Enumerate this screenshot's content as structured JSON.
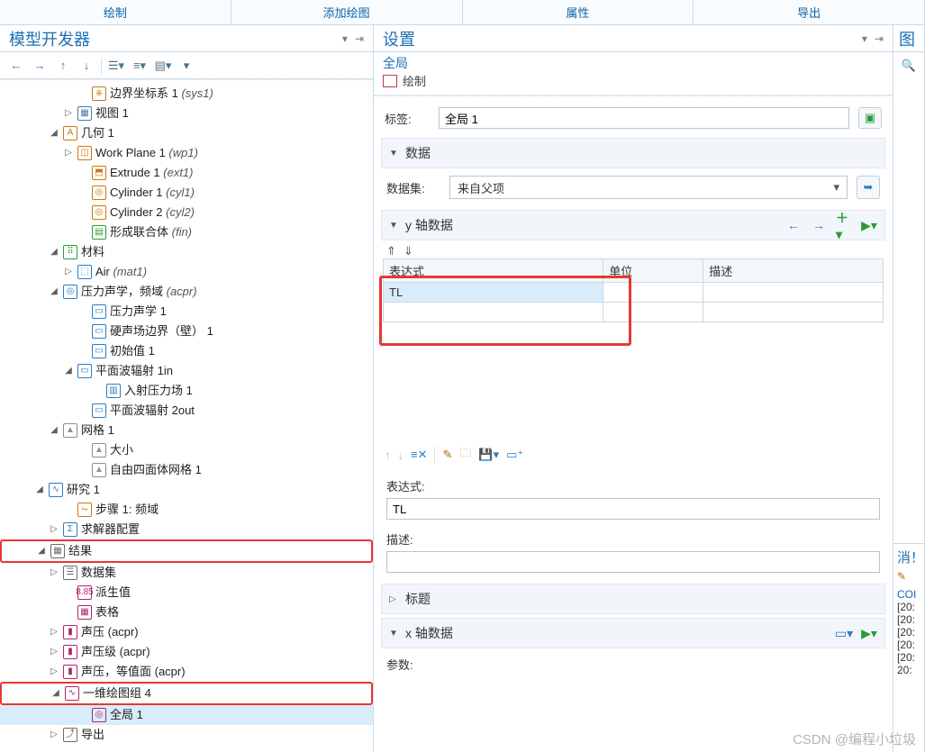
{
  "topbar": {
    "tabs": [
      "绘制",
      "添加绘图",
      "属性",
      "导出"
    ]
  },
  "left": {
    "title": "模型开发器",
    "tree": [
      {
        "d": 5,
        "e": "",
        "ic": "#c9770e",
        "ig": "⎈",
        "t": "边界坐标系 1",
        "s": "(sys1)"
      },
      {
        "d": 4,
        "e": "▷",
        "ic": "#4a7aa8",
        "ig": "▦",
        "t": "视图 1",
        "s": ""
      },
      {
        "d": 3,
        "e": "◢",
        "ic": "#c9770e",
        "ig": "A",
        "t": "几何 1",
        "s": ""
      },
      {
        "d": 4,
        "e": "▷",
        "ic": "#c9770e",
        "ig": "◫",
        "t": "Work Plane 1",
        "s": "(wp1)"
      },
      {
        "d": 5,
        "e": "",
        "ic": "#c9770e",
        "ig": "⬒",
        "t": "Extrude 1",
        "s": "(ext1)"
      },
      {
        "d": 5,
        "e": "",
        "ic": "#c9770e",
        "ig": "◎",
        "t": "Cylinder 1",
        "s": "(cyl1)"
      },
      {
        "d": 5,
        "e": "",
        "ic": "#c9770e",
        "ig": "◎",
        "t": "Cylinder 2",
        "s": "(cyl2)"
      },
      {
        "d": 5,
        "e": "",
        "ic": "#2b9c34",
        "ig": "▤",
        "t": "形成联合体",
        "s": "(fin)"
      },
      {
        "d": 3,
        "e": "◢",
        "ic": "#2b9c34",
        "ig": "⠿",
        "t": "材料",
        "s": ""
      },
      {
        "d": 4,
        "e": "▷",
        "ic": "#2a7cc6",
        "ig": "⬚",
        "t": "Air",
        "s": "(mat1)"
      },
      {
        "d": 3,
        "e": "◢",
        "ic": "#2a7cc6",
        "ig": "◎",
        "t": "压力声学，频域",
        "s": "(acpr)"
      },
      {
        "d": 5,
        "e": "",
        "ic": "#2a7cc6",
        "ig": "▭",
        "t": "压力声学 1",
        "s": ""
      },
      {
        "d": 5,
        "e": "",
        "ic": "#2a7cc6",
        "ig": "▭",
        "t": "硬声场边界（壁）  1",
        "s": ""
      },
      {
        "d": 5,
        "e": "",
        "ic": "#2a7cc6",
        "ig": "▭",
        "t": "初始值 1",
        "s": ""
      },
      {
        "d": 4,
        "e": "◢",
        "ic": "#2a7cc6",
        "ig": "▭",
        "t": "平面波辐射 1in",
        "s": ""
      },
      {
        "d": 6,
        "e": "",
        "ic": "#2a7cc6",
        "ig": "▥",
        "t": "入射压力场 1",
        "s": ""
      },
      {
        "d": 5,
        "e": "",
        "ic": "#2a7cc6",
        "ig": "▭",
        "t": "平面波辐射 2out",
        "s": ""
      },
      {
        "d": 3,
        "e": "◢",
        "ic": "#8f8f8f",
        "ig": "▲",
        "t": "网格 1",
        "s": ""
      },
      {
        "d": 5,
        "e": "",
        "ic": "#8f8f8f",
        "ig": "▲",
        "t": "大小",
        "s": ""
      },
      {
        "d": 5,
        "e": "",
        "ic": "#8f8f8f",
        "ig": "▲",
        "t": "自由四面体网格 1",
        "s": ""
      },
      {
        "d": 2,
        "e": "◢",
        "ic": "#2a7cc6",
        "ig": "∿",
        "t": "研究 1",
        "s": ""
      },
      {
        "d": 4,
        "e": "",
        "ic": "#c9770e",
        "ig": "⏦",
        "t": "步骤 1: 频域",
        "s": ""
      },
      {
        "d": 3,
        "e": "▷",
        "ic": "#2a7cc6",
        "ig": "Σ",
        "t": "求解器配置",
        "s": ""
      },
      {
        "d": 2,
        "e": "◢",
        "ic": "#6b6b6b",
        "ig": "▦",
        "t": "结果",
        "s": "",
        "hi": true
      },
      {
        "d": 3,
        "e": "▷",
        "ic": "#6b6b6b",
        "ig": "☰",
        "t": "数据集",
        "s": ""
      },
      {
        "d": 4,
        "e": "",
        "ic": "#b0266d",
        "ig": "8.85",
        "t": "派生值",
        "s": ""
      },
      {
        "d": 4,
        "e": "",
        "ic": "#b0266d",
        "ig": "▦",
        "t": "表格",
        "s": ""
      },
      {
        "d": 3,
        "e": "▷",
        "ic": "#b0266d",
        "ig": "▮",
        "t": "声压 (acpr)",
        "s": ""
      },
      {
        "d": 3,
        "e": "▷",
        "ic": "#b0266d",
        "ig": "▮",
        "t": "声压级 (acpr)",
        "s": ""
      },
      {
        "d": 3,
        "e": "▷",
        "ic": "#b0266d",
        "ig": "▮",
        "t": "声压，等值面 (acpr)",
        "s": ""
      },
      {
        "d": 3,
        "e": "◢",
        "ic": "#b0266d",
        "ig": "∿",
        "t": "一维绘图组 4",
        "s": "",
        "hi": true
      },
      {
        "d": 5,
        "e": "",
        "ic": "#b0266d",
        "ig": "◎",
        "t": "全局 1",
        "s": "",
        "sel": true
      },
      {
        "d": 3,
        "e": "▷",
        "ic": "#6b6b6b",
        "ig": "⤴",
        "t": "导出",
        "s": ""
      }
    ]
  },
  "right": {
    "title": "设置",
    "subtitle": "全局",
    "plot_label": "绘制",
    "label_row": {
      "label": "标签:",
      "value": "全局 1"
    },
    "section_data": {
      "title": "数据",
      "dataset_label": "数据集:",
      "dataset_value": "来自父项"
    },
    "section_y": {
      "title": "y 轴数据",
      "columns": [
        "表达式",
        "单位",
        "描述"
      ],
      "rows": [
        {
          "expr": "TL",
          "unit": "",
          "desc": ""
        },
        {
          "expr": "",
          "unit": "",
          "desc": ""
        }
      ],
      "expr_label": "表达式:",
      "expr_value": "TL",
      "desc_label": "描述:",
      "desc_value": ""
    },
    "section_title": {
      "title": "标题"
    },
    "section_x": {
      "title": "x 轴数据",
      "param_label": "参数:"
    }
  },
  "rightstrip": {
    "top_label": "图",
    "msg_title": "消！",
    "lines": [
      "COI",
      "[20:",
      "[20:",
      "[20:",
      "[20:",
      "[20:",
      "20:"
    ]
  },
  "watermark": "CSDN @编程小垃圾"
}
